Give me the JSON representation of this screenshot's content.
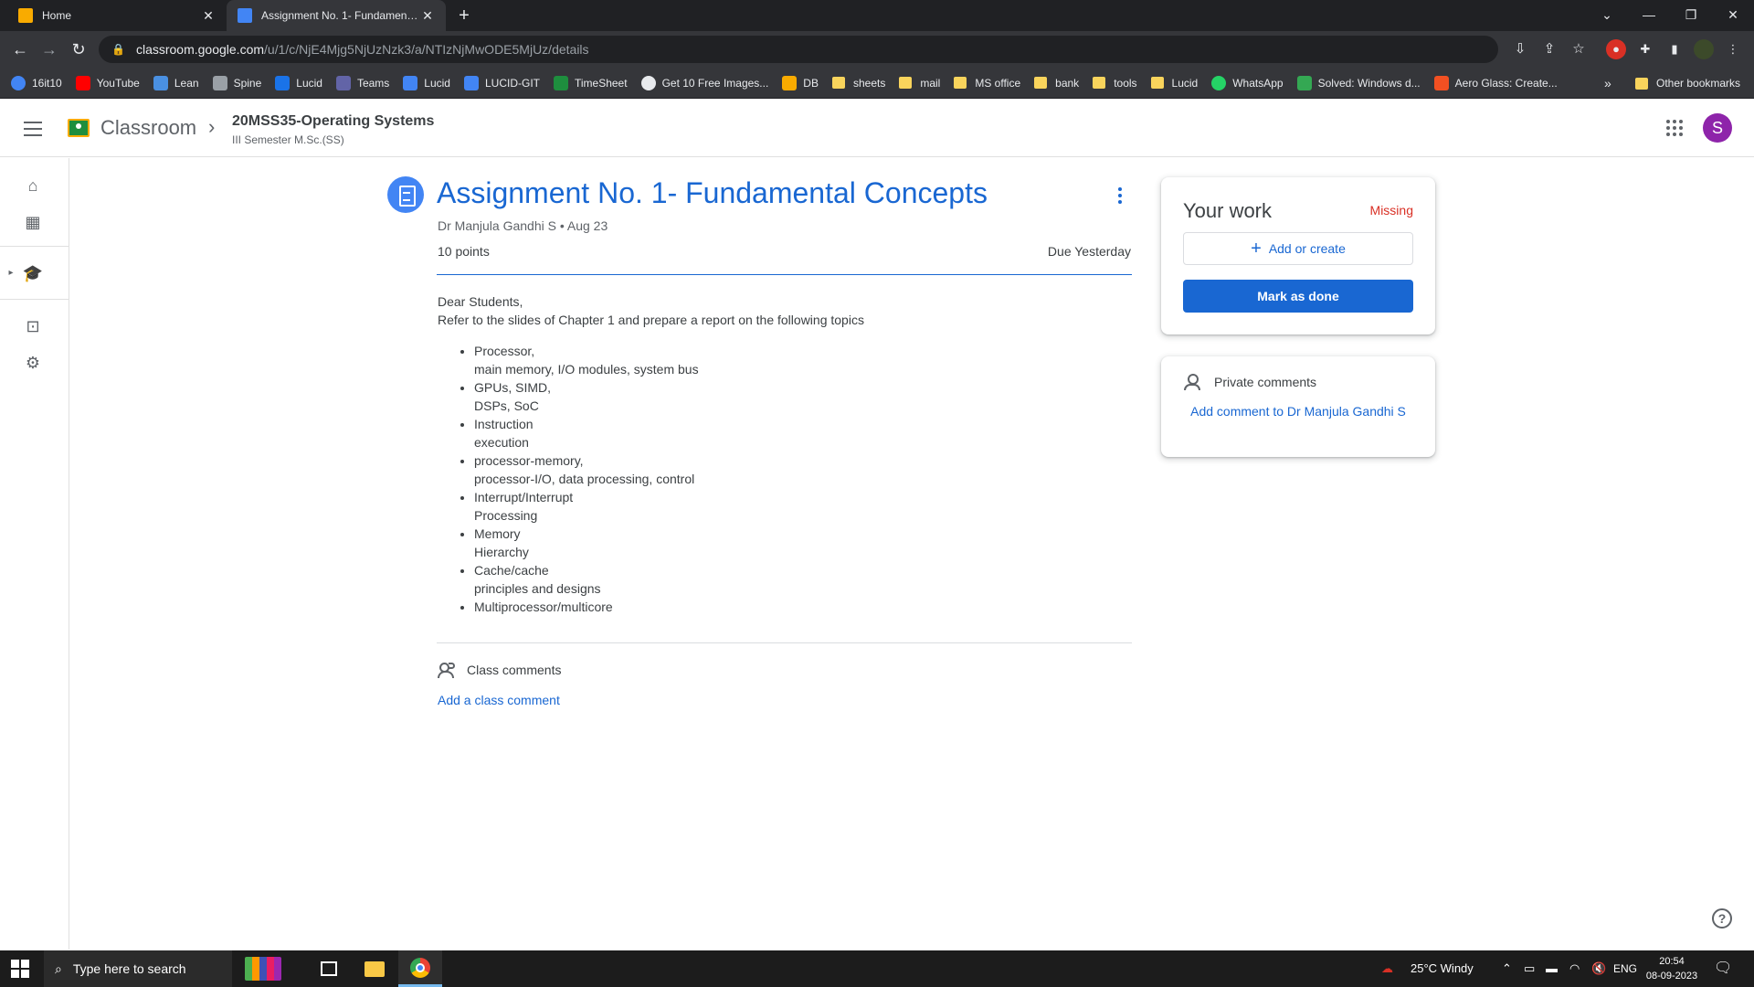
{
  "browser": {
    "tabs": [
      {
        "title": "Home",
        "favicon_color": "#f9ab00"
      },
      {
        "title": "Assignment No. 1- Fundamental Concepts",
        "favicon_color": "#4285f4"
      }
    ],
    "url_host": "classroom.google.com",
    "url_path": "/u/1/c/NjE4Mjg5NjUzNzk3/a/NTIzNjMwODE5MjUz/details",
    "bookmarks": [
      {
        "label": "16it10",
        "icon": "google-icon",
        "color": "#4285f4"
      },
      {
        "label": "YouTube",
        "icon": "youtube-icon",
        "color": "#ff0000"
      },
      {
        "label": "Lean",
        "icon": "lean-icon",
        "color": "#4a90e2"
      },
      {
        "label": "Spine",
        "icon": "spine-icon",
        "color": "#9aa0a6"
      },
      {
        "label": "Lucid",
        "icon": "cloud-icon",
        "color": "#1a73e8"
      },
      {
        "label": "Teams",
        "icon": "teams-icon",
        "color": "#6264a7"
      },
      {
        "label": "Lucid",
        "icon": "lucid-icon",
        "color": "#4285f4"
      },
      {
        "label": "LUCID-GIT",
        "icon": "lucid-git-icon",
        "color": "#4285f4"
      },
      {
        "label": "TimeSheet",
        "icon": "excel-icon",
        "color": "#1e8e3e"
      },
      {
        "label": "Get 10 Free Images...",
        "icon": "globe-icon",
        "color": "#e8eaed"
      },
      {
        "label": "DB",
        "icon": "db-icon",
        "color": "#f9ab00"
      },
      {
        "label": "sheets",
        "icon": "folder-icon",
        "color": "#f9d45c"
      },
      {
        "label": "mail",
        "icon": "folder-icon",
        "color": "#f9d45c"
      },
      {
        "label": "MS office",
        "icon": "folder-icon",
        "color": "#f9d45c"
      },
      {
        "label": "bank",
        "icon": "folder-icon",
        "color": "#f9d45c"
      },
      {
        "label": "tools",
        "icon": "folder-icon",
        "color": "#f9d45c"
      },
      {
        "label": "Lucid",
        "icon": "folder-icon",
        "color": "#f9d45c"
      },
      {
        "label": "WhatsApp",
        "icon": "whatsapp-icon",
        "color": "#25d366"
      },
      {
        "label": "Solved: Windows d...",
        "icon": "solved-icon",
        "color": "#34a853"
      },
      {
        "label": "Aero Glass: Create...",
        "icon": "windows-icon",
        "color": "#f25022"
      }
    ],
    "bookmarks_more": "»",
    "other_bookmarks": "Other bookmarks"
  },
  "header": {
    "app_name": "Classroom",
    "course_title": "20MSS35-Operating Systems",
    "course_subtitle": "III Semester M.Sc.(SS)",
    "avatar_letter": "S",
    "avatar_color": "#8e24aa"
  },
  "assignment": {
    "title": "Assignment No. 1- Fundamental Concepts",
    "meta": "Dr Manjula Gandhi S • Aug 23",
    "points": "10 points",
    "due": "Due Yesterday",
    "greeting": "Dear Students,",
    "intro": "Refer to the slides of Chapter 1 and prepare a report on the following topics",
    "topics": [
      [
        "Processor,",
        "main memory, I/O modules, system bus"
      ],
      [
        "GPUs, SIMD,",
        "DSPs, SoC"
      ],
      [
        "Instruction",
        "execution"
      ],
      [
        "processor-memory,",
        "processor-I/O, data processing, control"
      ],
      [
        "Interrupt/Interrupt",
        "Processing"
      ],
      [
        "Memory",
        "Hierarchy"
      ],
      [
        "Cache/cache",
        "principles and designs"
      ],
      [
        "Multiprocessor/multicore",
        ""
      ]
    ],
    "class_comments_label": "Class comments",
    "add_class_comment": "Add a class comment",
    "accent_color": "#1967d2"
  },
  "your_work": {
    "title": "Your work",
    "status": "Missing",
    "status_color": "#d93025",
    "add_or_create": "Add or create",
    "mark_done": "Mark as done"
  },
  "private_comments": {
    "title": "Private comments",
    "add_comment": "Add comment to Dr Manjula Gandhi S"
  },
  "taskbar": {
    "search_placeholder": "Type here to search",
    "weather": "25°C  Windy",
    "language": "ENG",
    "time": "20:54",
    "date": "08-09-2023"
  }
}
